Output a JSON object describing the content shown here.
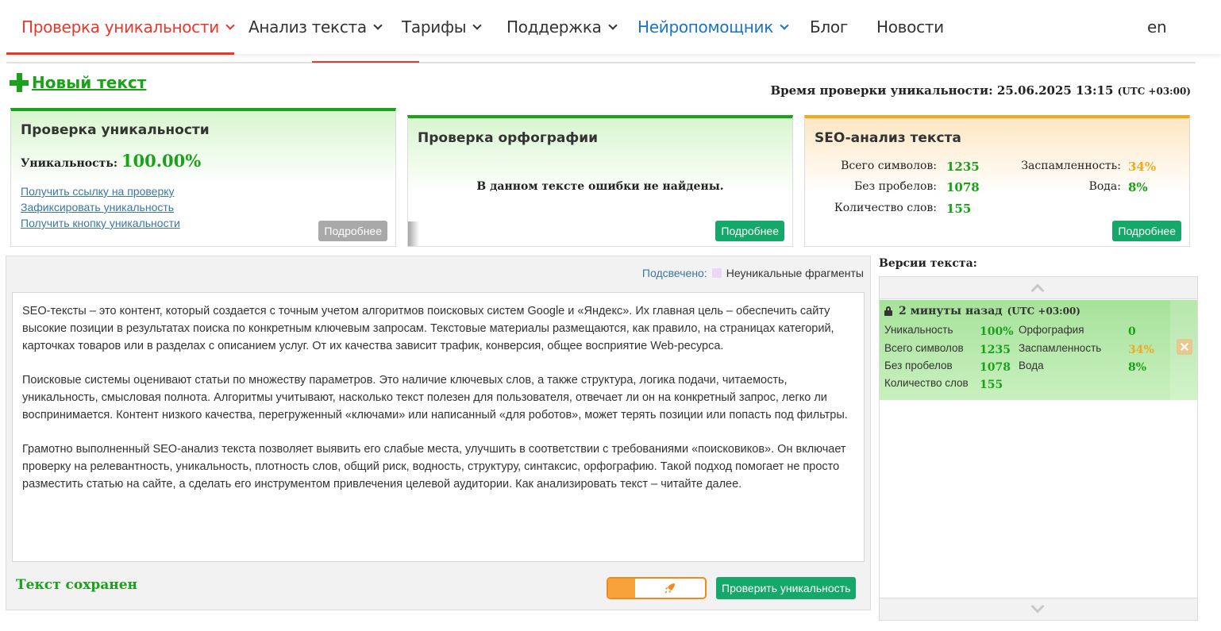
{
  "nav": {
    "items": [
      {
        "label": "Проверка уникальности",
        "has_dropdown": true,
        "state": "active"
      },
      {
        "label": "Анализ текста",
        "has_dropdown": true
      },
      {
        "label": "Тарифы",
        "has_dropdown": true
      },
      {
        "label": "Поддержка",
        "has_dropdown": true
      },
      {
        "label": "Нейропомощник",
        "has_dropdown": true,
        "color": "#1a73c9"
      },
      {
        "label": "Блог",
        "has_dropdown": false
      },
      {
        "label": "Новости",
        "has_dropdown": false
      }
    ],
    "language": "en",
    "active_color": "#e8382b"
  },
  "new_text": {
    "label": "Новый текст",
    "icon": "plus-icon"
  },
  "check_time": {
    "label": "Время проверки уникальности: 25.06.2025 13:15",
    "timezone": "(UTC +03:00)"
  },
  "uniqueness_card": {
    "title": "Проверка уникальности",
    "uniqueness_label": "Уникальность:",
    "uniqueness_value": "100.00%",
    "links": [
      "Получить ссылку на проверку",
      "Зафиксировать уникальность",
      "Получить кнопку уникальности"
    ],
    "more_button": "Подробнее"
  },
  "spelling_card": {
    "title": "Проверка орфографии",
    "message": "В данном тексте ошибки не найдены.",
    "more_button": "Подробнее"
  },
  "seo_card": {
    "title": "SEO-анализ текста",
    "total_chars_label": "Всего символов:",
    "total_chars": "1235",
    "no_spaces_label": "Без пробелов:",
    "no_spaces": "1078",
    "word_count_label": "Количество слов:",
    "word_count": "155",
    "spam_label": "Заспамленность:",
    "spam": "34%",
    "water_label": "Вода:",
    "water": "8%",
    "more_button": "Подробнее"
  },
  "editor": {
    "highlight_label": "Подсвечено:",
    "highlight_legend": "Неуникальные фрагменты",
    "paragraphs": [
      "SEO-тексты – это контент, который создается с точным учетом алгоритмов поисковых систем Google и «Яндекс». Их главная цель – обеспечить сайту высокие позиции в результатах поиска по конкретным ключевым запросам. Текстовые материалы размещаются, как правило, на страницах категорий, карточках товаров или в разделах с описанием услуг. От их качества зависит трафик, конверсия, общее восприятие Web-ресурса.",
      "Поисковые системы оценивают статьи по множеству параметров. Это наличие ключевых слов, а также структура, логика подачи, читаемость, уникальность, смысловая полнота. Алгоритмы учитывают, насколько текст полезен для пользователя, отвечает ли он на конкретный запрос, легко ли воспринимается. Контент низкого качества, перегруженный «ключами» или написанный «для роботов», может терять позиции или попасть под фильтры.",
      "Грамотно выполненный SEO-анализ текста позволяет выявить его слабые места, улучшить в соответствии с требованиями «поисковиков». Он включает проверку на релевантность, уникальность, плотность слов, общий риск, водность, структуру, синтаксис, орфографию. Такой подход помогает не просто разместить статью на сайте, а сделать его инструментом привлечения целевой аудитории. Как анализировать текст – читайте далее."
    ],
    "status": "Текст сохранен",
    "check_button": "Проверить уникальность",
    "toggle_icon": "rocket-icon"
  },
  "versions": {
    "title": "Версии текста:",
    "items": [
      {
        "time": "2 минуты назад",
        "timezone": "(UTC +03:00)",
        "uniqueness_label": "Уникальность",
        "uniqueness": "100%",
        "spelling_label": "Орфография",
        "spelling": "0",
        "total_chars_label": "Всего символов",
        "total_chars": "1235",
        "spam_label": "Заспамленность",
        "spam": "34%",
        "no_spaces_label": "Без пробелов",
        "no_spaces": "1078",
        "water_label": "Вода",
        "water": "8%",
        "word_count_label": "Количество слов",
        "word_count": "155"
      }
    ]
  }
}
